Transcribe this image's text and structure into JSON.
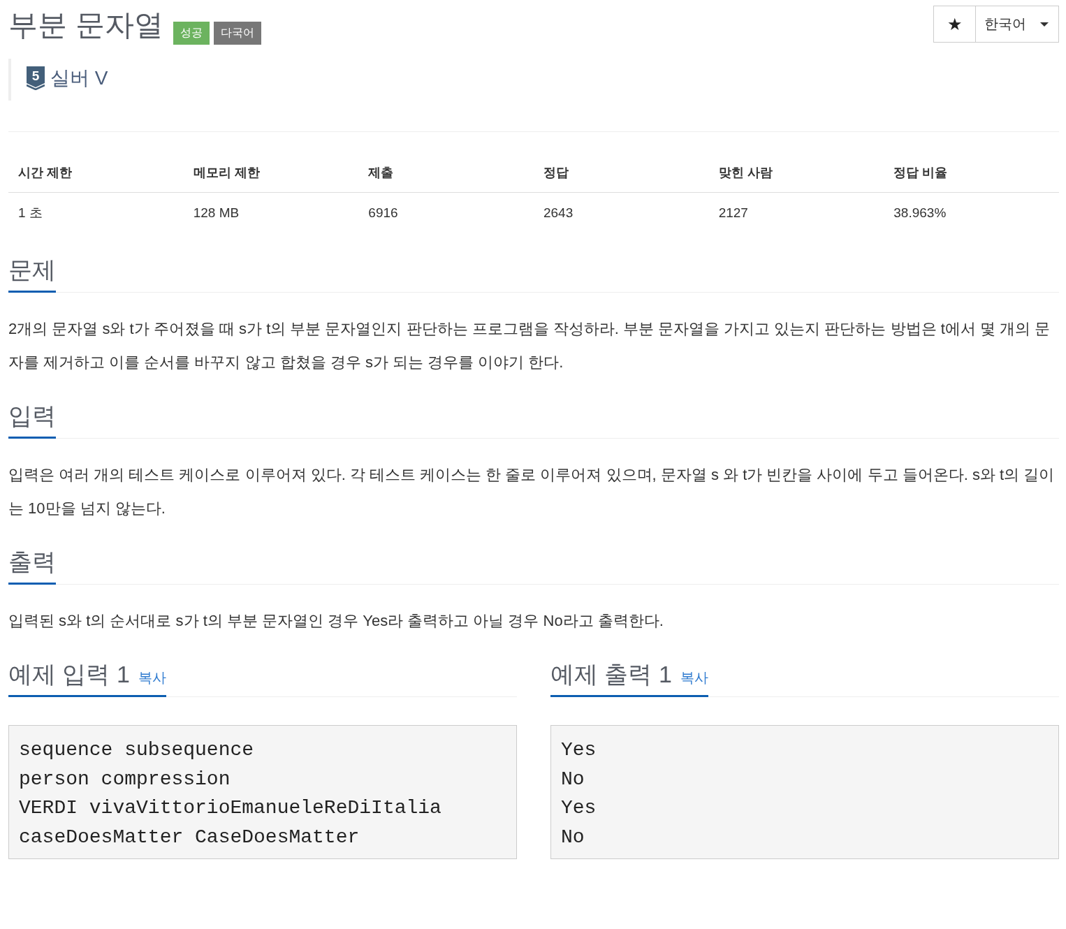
{
  "title": "부분 문자열",
  "badges": [
    {
      "label": "성공",
      "kind": "success"
    },
    {
      "label": "다국어",
      "kind": "multilang"
    }
  ],
  "toolbar": {
    "star": "★",
    "language": "한국어"
  },
  "tier": {
    "number": "5",
    "label": "실버 V"
  },
  "stats": {
    "columns": [
      "시간 제한",
      "메모리 제한",
      "제출",
      "정답",
      "맞힌 사람",
      "정답 비율"
    ],
    "rows": [
      [
        "1 초",
        "128 MB",
        "6916",
        "2643",
        "2127",
        "38.963%"
      ]
    ]
  },
  "sections": [
    {
      "heading": "문제",
      "text": "2개의 문자열 s와 t가 주어졌을 때 s가 t의 부분 문자열인지 판단하는 프로그램을 작성하라. 부분 문자열을 가지고 있는지 판단하는 방법은 t에서 몇 개의 문자를 제거하고 이를 순서를 바꾸지 않고 합쳤을 경우 s가 되는 경우를 이야기 한다."
    },
    {
      "heading": "입력",
      "text": "입력은 여러 개의 테스트 케이스로 이루어져 있다. 각 테스트 케이스는 한 줄로 이루어져 있으며, 문자열 s 와 t가 빈칸을 사이에 두고 들어온다. s와 t의 길이는 10만을 넘지 않는다."
    },
    {
      "heading": "출력",
      "text": "입력된 s와 t의 순서대로 s가 t의 부분 문자열인 경우 Yes라 출력하고 아닐 경우 No라고 출력한다."
    }
  ],
  "samples": [
    {
      "heading": "예제 입력 1",
      "copy": "복사",
      "lines": [
        "sequence subsequence",
        "person compression",
        "VERDI vivaVittorioEmanueleReDiItalia",
        "caseDoesMatter CaseDoesMatter"
      ]
    },
    {
      "heading": "예제 출력 1",
      "copy": "복사",
      "lines": [
        "Yes",
        "No",
        "Yes",
        "No"
      ]
    }
  ]
}
